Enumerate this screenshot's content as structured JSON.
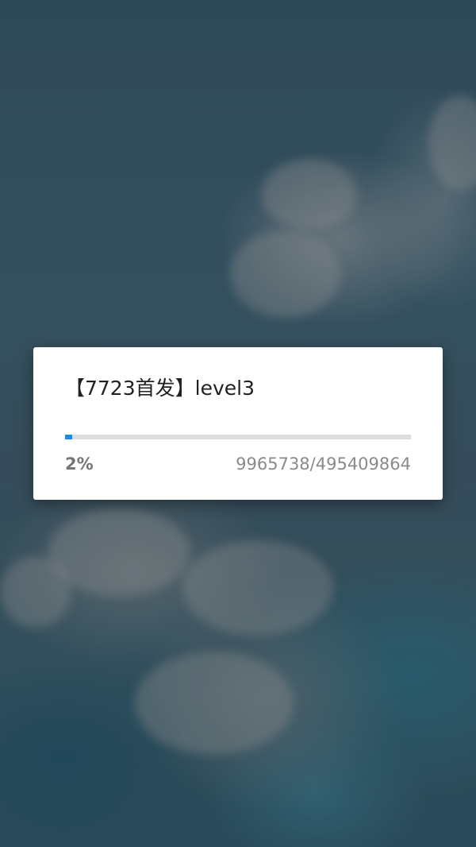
{
  "dialog": {
    "title": "【7723首发】level3",
    "progress": {
      "fraction": 0.02,
      "percent_label": "2%",
      "count_label": "9965738/495409864",
      "fill_color": "#1e88e5",
      "track_color": "#dddddd"
    }
  }
}
